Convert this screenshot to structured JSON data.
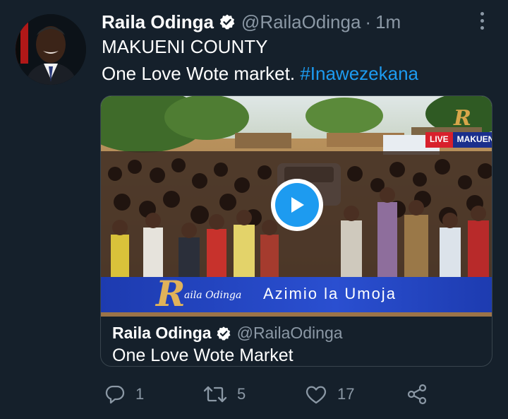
{
  "tweet": {
    "author_name": "Raila Odinga",
    "handle": "@RailaOdinga",
    "separator": "·",
    "time": "1m",
    "line1": "MAKUENI COUNTY",
    "line2_text": "One Love Wote market.",
    "hashtag": "#Inawezekana"
  },
  "media": {
    "live_label": "LIVE",
    "live_location": "MAKUENI",
    "lower_third_initial": "R",
    "lower_third_name": "aila Odinga",
    "lower_third_slogan": "Azimio la Umoja"
  },
  "quoted": {
    "author_name": "Raila Odinga",
    "handle": "@RailaOdinga",
    "text": "One Love Wote Market"
  },
  "actions": {
    "replies": "1",
    "retweets": "5",
    "likes": "17"
  },
  "icons": [
    "verified-badge-icon",
    "more-options-icon",
    "play-icon",
    "reply-icon",
    "retweet-icon",
    "like-icon",
    "share-icon"
  ],
  "colors": {
    "background": "#15202b",
    "accent": "#1d9bf0",
    "secondary_text": "#8b98a5",
    "border": "#38444d"
  }
}
